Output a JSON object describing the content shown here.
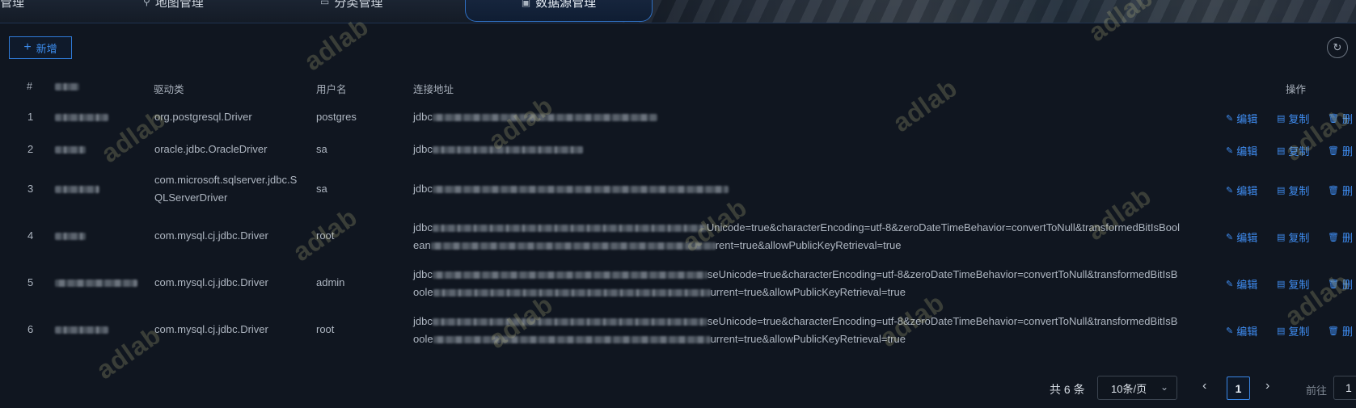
{
  "nav": {
    "tabs": [
      {
        "label": "管理",
        "icon": "",
        "active": false
      },
      {
        "label": "地图管理",
        "icon": "map-icon",
        "active": false
      },
      {
        "label": "分类管理",
        "icon": "folder-icon",
        "active": false
      },
      {
        "label": "数据源管理",
        "icon": "database-icon",
        "active": true
      }
    ]
  },
  "toolbar": {
    "add_label": "新增",
    "add_icon": "plus-icon",
    "refresh_icon": "refresh-icon"
  },
  "table": {
    "headers": {
      "index": "#",
      "name": "",
      "driver": "驱动类",
      "username": "用户名",
      "url": "连接地址",
      "actions": "操作"
    },
    "rows": [
      {
        "index": "1",
        "driver": "org.postgresql.Driver",
        "username": "postgres",
        "url_prefix": "jdbc",
        "url_rest": "",
        "url_line2_prefix": "",
        "url_line2_rest": ""
      },
      {
        "index": "2",
        "driver": "oracle.jdbc.OracleDriver",
        "username": "sa",
        "url_prefix": "jdbc",
        "url_rest": "",
        "url_line2_prefix": "",
        "url_line2_rest": ""
      },
      {
        "index": "3",
        "driver": "com.microsoft.sqlserver.jdbc.SQLServerDriver",
        "username": "sa",
        "url_prefix": "jdbc",
        "url_rest": "",
        "url_line2_prefix": "",
        "url_line2_rest": ""
      },
      {
        "index": "4",
        "driver": "com.mysql.cj.jdbc.Driver",
        "username": "root",
        "url_prefix": "jdbc",
        "url_rest": "Unicode=true&characterEncoding=utf-8&zeroDateTimeBehavior=convertToNull&transformedBitIsBool",
        "url_line2_prefix": "ean",
        "url_line2_rest": "rent=true&allowPublicKeyRetrieval=true"
      },
      {
        "index": "5",
        "driver": "com.mysql.cj.jdbc.Driver",
        "username": "admin",
        "url_prefix": "jdbc",
        "url_rest": "seUnicode=true&characterEncoding=utf-8&zeroDateTimeBehavior=convertToNull&transformedBitIsB",
        "url_line2_prefix": "oole",
        "url_line2_rest": "urrent=true&allowPublicKeyRetrieval=true"
      },
      {
        "index": "6",
        "driver": "com.mysql.cj.jdbc.Driver",
        "username": "root",
        "url_prefix": "jdbc",
        "url_rest": "seUnicode=true&characterEncoding=utf-8&zeroDateTimeBehavior=convertToNull&transformedBitIsB",
        "url_line2_prefix": "oole",
        "url_line2_rest": "urrent=true&allowPublicKeyRetrieval=true"
      }
    ],
    "actions": {
      "edit": "编辑",
      "copy": "复制",
      "delete": "删"
    }
  },
  "pagination": {
    "total": "共 6 条",
    "page_size": "10条/页",
    "current_page": "1",
    "goto_label": "前往",
    "goto_value": "1"
  },
  "watermark": {
    "text": "adlab"
  },
  "colors": {
    "accent": "#3f8df2",
    "background": "#101620"
  }
}
